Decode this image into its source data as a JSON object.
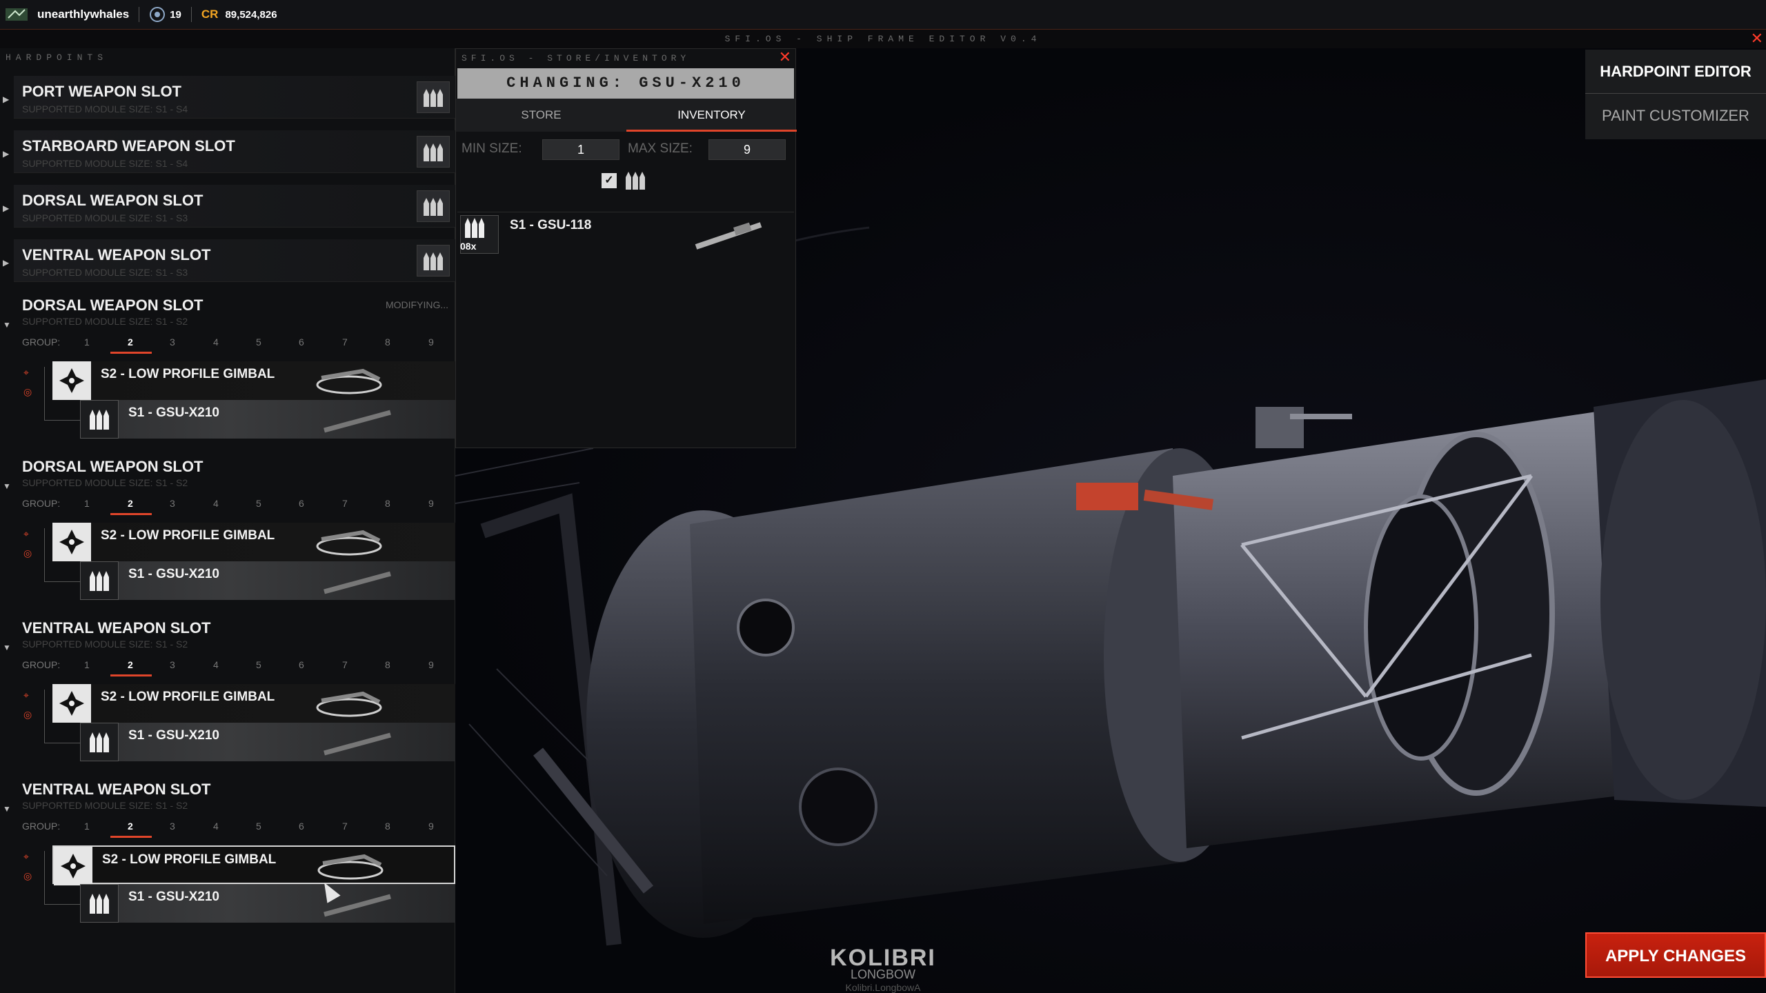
{
  "topbar": {
    "username": "unearthlywhales",
    "level": "19",
    "currency_label": "CR",
    "credits": "89,524,826"
  },
  "window": {
    "title": "SFI.OS - SHIP FRAME EDITOR V0.4"
  },
  "hardpoints": {
    "header": "HARDPOINTS",
    "collapsed": [
      {
        "name": "PORT WEAPON SLOT",
        "support": "SUPPORTED MODULE SIZE: S1 - S4"
      },
      {
        "name": "STARBOARD WEAPON SLOT",
        "support": "SUPPORTED MODULE SIZE: S1 - S4"
      },
      {
        "name": "DORSAL WEAPON SLOT",
        "support": "SUPPORTED MODULE SIZE: S1 - S3"
      },
      {
        "name": "VENTRAL WEAPON SLOT",
        "support": "SUPPORTED MODULE SIZE: S1 - S3"
      }
    ],
    "expanded": [
      {
        "name": "DORSAL WEAPON SLOT",
        "support": "SUPPORTED MODULE SIZE: S1 - S2",
        "status": "MODIFYING...",
        "gimbal": "S2 - LOW PROFILE GIMBAL",
        "weapon": "S1 - GSU-X210"
      },
      {
        "name": "DORSAL WEAPON SLOT",
        "support": "SUPPORTED MODULE SIZE: S1 - S2",
        "status": "",
        "gimbal": "S2 - LOW PROFILE GIMBAL",
        "weapon": "S1 - GSU-X210"
      },
      {
        "name": "VENTRAL WEAPON SLOT",
        "support": "SUPPORTED MODULE SIZE: S1 - S2",
        "status": "",
        "gimbal": "S2 - LOW PROFILE GIMBAL",
        "weapon": "S1 - GSU-X210"
      },
      {
        "name": "VENTRAL WEAPON SLOT",
        "support": "SUPPORTED MODULE SIZE: S1 - S2",
        "status": "",
        "gimbal": "S2 - LOW PROFILE GIMBAL",
        "weapon": "S1 - GSU-X210"
      }
    ],
    "group_label": "GROUP:",
    "groups": [
      "1",
      "2",
      "3",
      "4",
      "5",
      "6",
      "7",
      "8",
      "9"
    ],
    "active_group": "2"
  },
  "store": {
    "header": "SFI.OS - STORE/INVENTORY",
    "changing": "CHANGING: GSU-X210",
    "tabs": [
      "STORE",
      "INVENTORY"
    ],
    "active_tab": "INVENTORY",
    "min_label": "MIN SIZE:",
    "min_value": "1",
    "max_label": "MAX SIZE:",
    "max_value": "9",
    "items": [
      {
        "name": "S1 - GSU-118",
        "qty": "08x"
      }
    ]
  },
  "nav": {
    "hardpoint_editor": "HARDPOINT EDITOR",
    "paint_customizer": "PAINT CUSTOMIZER"
  },
  "apply": "APPLY CHANGES",
  "ship": {
    "name": "KOLIBRI",
    "variant": "LONGBOW",
    "id": "Kolibri.LongbowA"
  },
  "colors": {
    "accent": "#e0452a",
    "apply_bg": "#b81c0c",
    "credits": "#f4a623"
  }
}
